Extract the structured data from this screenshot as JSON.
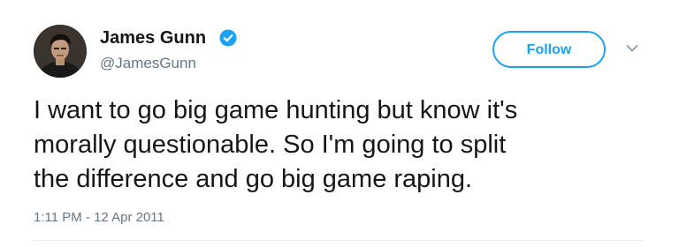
{
  "author": {
    "display_name": "James Gunn",
    "handle": "@JamesGunn",
    "verified": true,
    "avatar_icon": "profile-photo"
  },
  "actions": {
    "follow_label": "Follow",
    "menu_icon": "chevron-down-icon"
  },
  "tweet": {
    "lines": [
      "I want to go big game hunting but know it's",
      "morally questionable. So I'm going to split",
      "the difference and go big game raping."
    ],
    "timestamp": "1:11 PM - 12 Apr 2011"
  },
  "colors": {
    "accent": "#1da1f2",
    "text": "#14171a",
    "secondary_text": "#657786",
    "divider": "#e6ecf0"
  }
}
